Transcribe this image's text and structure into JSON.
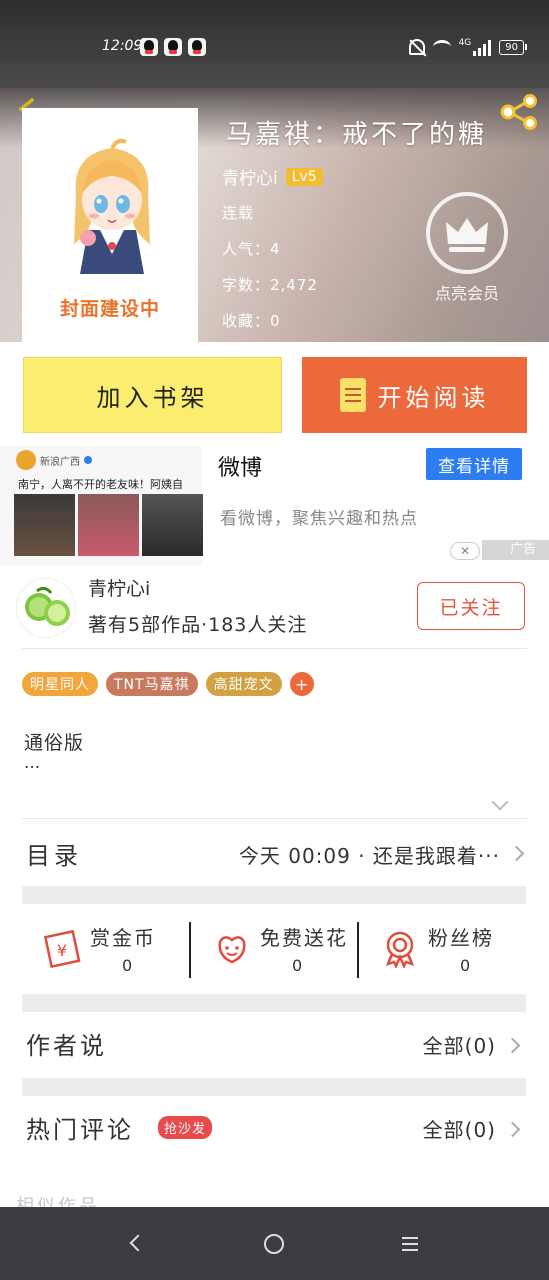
{
  "status_bar": {
    "time": "12:09",
    "network": "4G",
    "battery": "90"
  },
  "book": {
    "title": "马嘉祺：戒不了的糖",
    "cover_placeholder": "封面建设中",
    "author": "青柠心i",
    "author_level": "Lv5",
    "status": "连载",
    "popularity": "人气：4",
    "word_count": "字数：2,472",
    "favorites": "收藏：0",
    "vip_label": "点亮会员"
  },
  "actions": {
    "add_shelf": "加入书架",
    "start_read": "开始阅读"
  },
  "ad": {
    "source": "新浪广西",
    "headline": "南宁，人离不开的老友味！阿姨自创...",
    "brand": "微博",
    "cta": "查看详情",
    "description": "看微博，聚焦兴趣和热点",
    "tag": "广告",
    "close": "✕"
  },
  "author_card": {
    "name": "青柠心i",
    "stats": "著有5部作品·183人关注",
    "follow_label": "已关注"
  },
  "tags": [
    {
      "label": "明星同人",
      "color": "#f1a53a"
    },
    {
      "label": "TNT马嘉祺",
      "color": "#c77a5f"
    },
    {
      "label": "高甜宠文",
      "color": "#d3a044"
    }
  ],
  "tag_add": "+",
  "intro": {
    "text": "通俗版",
    "more": "···"
  },
  "catalog": {
    "label": "目录",
    "latest": "今天 00:09 · 还是我跟着···"
  },
  "rewards": [
    {
      "label": "赏金币",
      "value": "0"
    },
    {
      "label": "免费送花",
      "value": "0"
    },
    {
      "label": "粉丝榜",
      "value": "0"
    }
  ],
  "author_say": {
    "label": "作者说",
    "all": "全部(0)"
  },
  "hot_comments": {
    "label": "热门评论",
    "badge": "抢沙发",
    "all": "全部(0)"
  },
  "peek_text": "相似作品"
}
